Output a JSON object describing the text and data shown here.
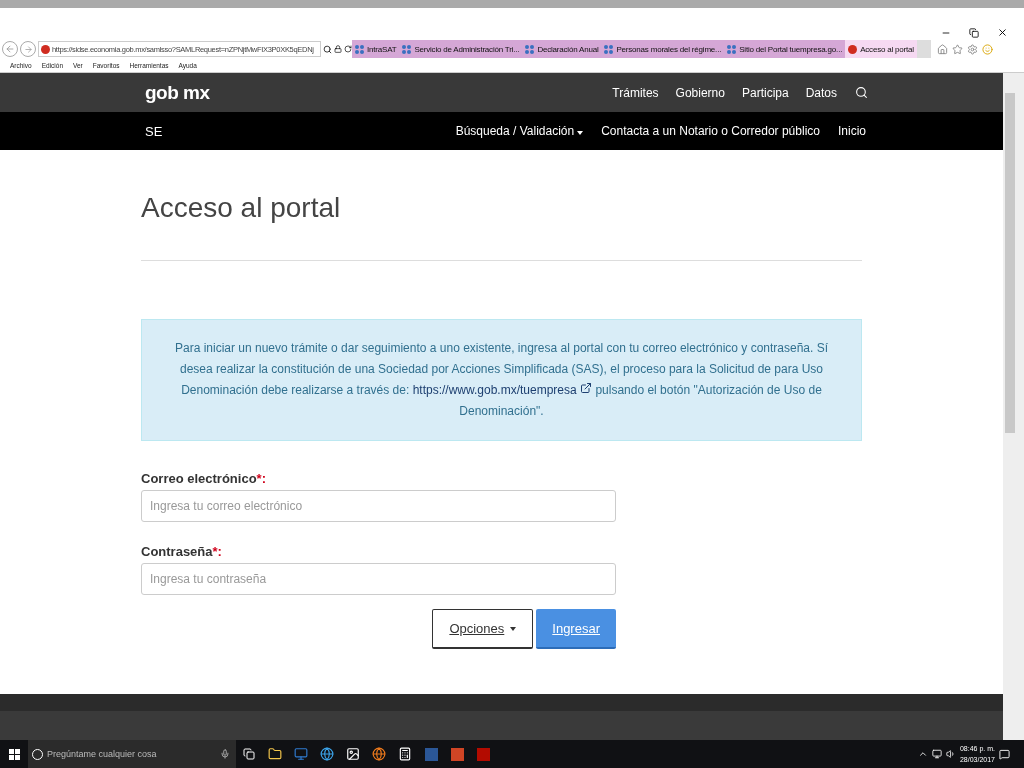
{
  "browser": {
    "address": "https://sidse.economia.gob.mx/samlsso?SAMLRequest=nZPNjtMwFIX3P0XK5qEDNj",
    "tabs": [
      {
        "label": "IntraSAT",
        "kind": "site",
        "selected": false
      },
      {
        "label": "Servicio de Administración Tri...",
        "kind": "site",
        "selected": false
      },
      {
        "label": "Declaración Anual",
        "kind": "site",
        "selected": false
      },
      {
        "label": "Personas morales del régime...",
        "kind": "site",
        "selected": false
      },
      {
        "label": "Sitio del Portal tuempresa.go...",
        "kind": "site",
        "selected": false
      },
      {
        "label": "Acceso al portal",
        "kind": "gob",
        "selected": true
      }
    ],
    "menu": [
      "Archivo",
      "Edición",
      "Ver",
      "Favoritos",
      "Herramientas",
      "Ayuda"
    ]
  },
  "header": {
    "logo": "gob mx",
    "links": [
      "Trámites",
      "Gobierno",
      "Participa",
      "Datos"
    ]
  },
  "subnav": {
    "title": "SE",
    "links": [
      {
        "label": "Búsqueda / Validación",
        "dropdown": true
      },
      {
        "label": "Contacta a un Notario o Corredor público",
        "dropdown": false
      },
      {
        "label": "Inicio",
        "dropdown": false
      }
    ]
  },
  "page": {
    "title": "Acceso al portal",
    "notice": {
      "before": "Para iniciar un nuevo trámite o dar seguimiento a uno existente, ingresa al portal con tu correo electrónico y contraseña. Sí desea realizar la constitución de una Sociedad por Acciones Simplificada (SAS), el proceso para la Solicitud de para Uso Denominación debe realizarse a través de:",
      "link": "https://www.gob.mx/tuempresa",
      "after": "pulsando el botón \"Autorización de Uso de Denominación\"."
    },
    "fields": [
      {
        "label": "Correo electrónico",
        "required": "*:",
        "placeholder": "Ingresa tu correo electrónico"
      },
      {
        "label": "Contraseña",
        "required": "*:",
        "placeholder": "Ingresa tu contraseña"
      }
    ],
    "buttons": [
      {
        "label": "Opciones",
        "kind": "dropdown"
      },
      {
        "label": "Ingresar",
        "kind": "primary"
      }
    ]
  },
  "taskbar": {
    "search_placeholder": "Pregúntame cualquier cosa",
    "time": "08:46 p. m.",
    "date": "28/03/2017"
  }
}
